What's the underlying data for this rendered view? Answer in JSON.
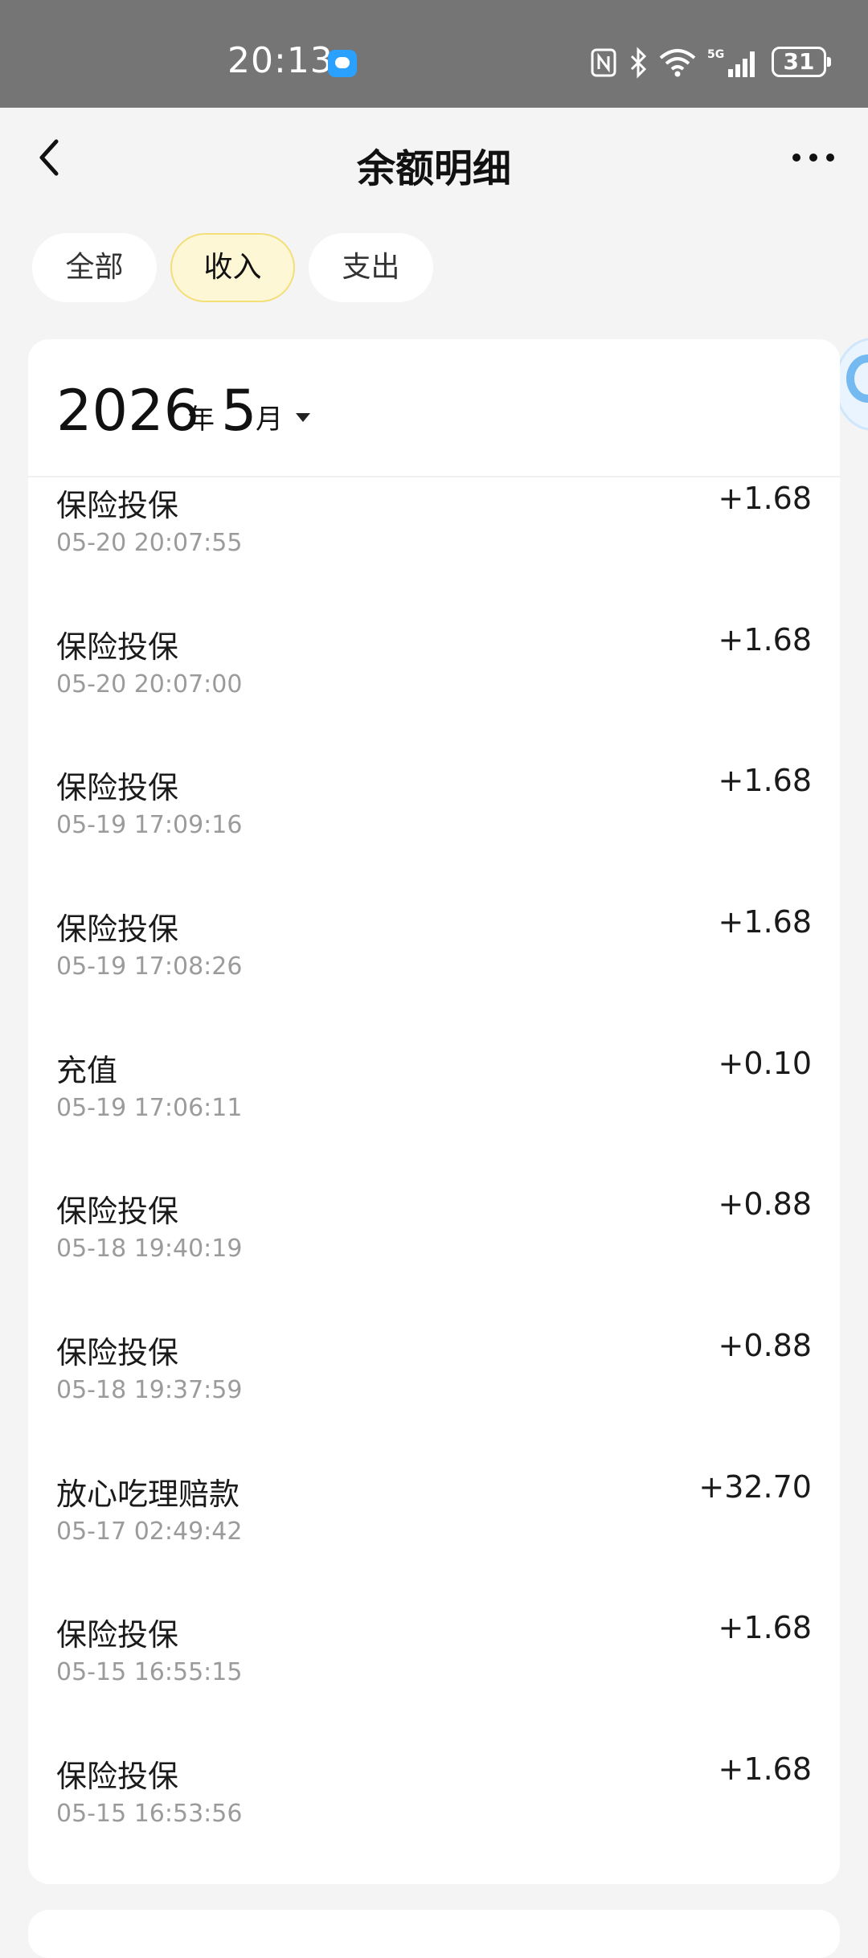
{
  "status_bar": {
    "time": "20:13",
    "battery": "31"
  },
  "header": {
    "title": "余额明细"
  },
  "tabs": [
    {
      "label": "全部",
      "active": false
    },
    {
      "label": "收入",
      "active": true
    },
    {
      "label": "支出",
      "active": false
    }
  ],
  "month_picker": {
    "year": "2026",
    "year_unit": "年",
    "month": "5",
    "month_unit": "月"
  },
  "transactions": [
    {
      "title": "保险投保",
      "time": "05-20 20:07:55",
      "amount": "+1.68"
    },
    {
      "title": "保险投保",
      "time": "05-20 20:07:00",
      "amount": "+1.68"
    },
    {
      "title": "保险投保",
      "time": "05-19 17:09:16",
      "amount": "+1.68"
    },
    {
      "title": "保险投保",
      "time": "05-19 17:08:26",
      "amount": "+1.68"
    },
    {
      "title": "充值",
      "time": "05-19 17:06:11",
      "amount": "+0.10"
    },
    {
      "title": "保险投保",
      "time": "05-18 19:40:19",
      "amount": "+0.88"
    },
    {
      "title": "保险投保",
      "time": "05-18 19:37:59",
      "amount": "+0.88"
    },
    {
      "title": "放心吃理赔款",
      "time": "05-17 02:49:42",
      "amount": "+32.70"
    },
    {
      "title": "保险投保",
      "time": "05-15 16:55:15",
      "amount": "+1.68"
    },
    {
      "title": "保险投保",
      "time": "05-15 16:53:56",
      "amount": "+1.68"
    }
  ],
  "colors": {
    "active_tab_bg": "#fdf7d6",
    "active_tab_border": "#f3df7a",
    "status_bar_bg": "#757575",
    "time_text": "#9b9b9b"
  }
}
